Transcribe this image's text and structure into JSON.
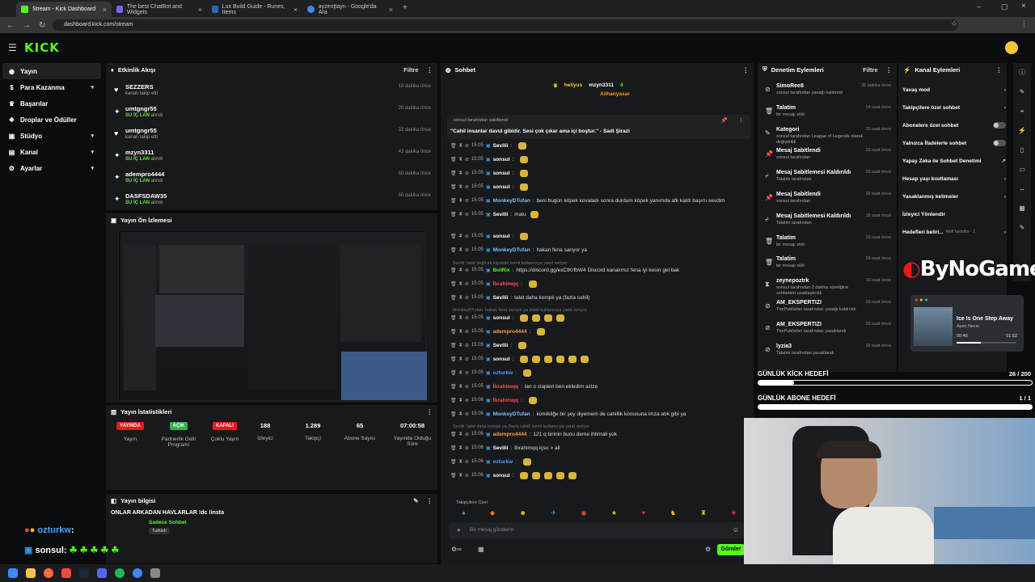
{
  "browser": {
    "tabs": [
      {
        "label": "Stream - Kick Dashboard",
        "color": "#53fc18"
      },
      {
        "label": "The best ChatBot and Widgets",
        "color": "#7b61ff"
      },
      {
        "label": "Lux Build Guide - Runes, Items",
        "color": "#2b6cb0"
      },
      {
        "label": "ayzenţtayn - Google'da Ara",
        "color": "#4285f4"
      }
    ],
    "url": "dashboard.kick.com/stream"
  },
  "brand": {
    "logo": "KICK"
  },
  "sidebar": {
    "items": [
      {
        "label": "Yayın",
        "icon": "broadcast-icon",
        "chev": false
      },
      {
        "label": "Para Kazanma",
        "icon": "money-icon",
        "chev": true
      },
      {
        "label": "Başarılar",
        "icon": "trophy-icon",
        "chev": false
      },
      {
        "label": "Droplar ve Ödüller",
        "icon": "gift-icon",
        "chev": false
      },
      {
        "label": "Stüdyo",
        "icon": "studio-icon",
        "chev": true
      },
      {
        "label": "Kanal",
        "icon": "channel-icon",
        "chev": true
      },
      {
        "label": "Ayarlar",
        "icon": "settings-icon",
        "chev": true
      }
    ]
  },
  "activity": {
    "title": "Etkinlik Akışı",
    "filter": "Filtre",
    "items": [
      {
        "name": "SEZZERS",
        "sub": "kanalı takip etti",
        "highlight": "",
        "time": "18 dakika önce",
        "icon": "heart-icon"
      },
      {
        "name": "umtgngr55",
        "sub": " alındı",
        "highlight": "SU İÇ LAN",
        "time": "20 dakika önce",
        "icon": "gift-icon"
      },
      {
        "name": "umtgngr55",
        "sub": "kanalı takip etti",
        "highlight": "",
        "time": "32 dakika önce",
        "icon": "heart-icon"
      },
      {
        "name": "mzyn3311",
        "sub": " alındı",
        "highlight": "SU İÇ LAN",
        "time": "43 dakika önce",
        "icon": "gift-icon"
      },
      {
        "name": "adempro4444",
        "sub": " alındı",
        "highlight": "SU İÇ LAN",
        "time": "50 dakika önce",
        "icon": "gift-icon"
      },
      {
        "name": "DASFSDAW35",
        "sub": " alındı",
        "highlight": "SU İÇ LAN",
        "time": "50 dakika önce",
        "icon": "gift-icon"
      }
    ]
  },
  "preview": {
    "title": "Yayın Ön İzlemesi"
  },
  "stats": {
    "title": "Yayın İstatistikleri",
    "items": [
      {
        "badge": "YAYINDA",
        "badge_color": "#e91916",
        "label": "Yayın"
      },
      {
        "badge": "AÇIK",
        "badge_color": "#2fb34a",
        "label": "Partnerlik Gelir Programı"
      },
      {
        "badge": "KAPALI",
        "badge_color": "#e91916",
        "label": "Çoklu Yayın"
      },
      {
        "value": "188",
        "label": "İzleyici"
      },
      {
        "value": "1.289",
        "label": "Takipçi"
      },
      {
        "value": "65",
        "label": "Abone Sayısı"
      },
      {
        "value": "07:00:58",
        "label": "Yayında Olduğu Süre"
      }
    ]
  },
  "streaminfo": {
    "title": "Yayın bilgisi",
    "name": "ONLAR ARKADAN HAVLARLAR !dc !insta",
    "tag": "Sadece Sohbet",
    "category": "Turkish"
  },
  "overlay_chat": [
    {
      "user": "ozturkw",
      "text": ":"
    },
    {
      "user": "sonsul",
      "text": ":"
    }
  ],
  "chat": {
    "title": "Sohbet",
    "top": [
      {
        "name": "heliyus",
        "count": "7"
      },
      {
        "name": "mzyn3311",
        "count": "4"
      },
      {
        "name": "Alihanyasar",
        "count": "1"
      }
    ],
    "pinned": {
      "by": "sonsul tarafından sabitlendi",
      "text": "\"Cahil insanlar davul gibidir. Sesi çok çıkar ama içi boştur.\" - Sadi Şirazi"
    },
    "lines": [
      {
        "time": "15:05",
        "user": "Sevilii",
        "ucolor": "#ffffff",
        "text": "",
        "emotes": 1
      },
      {
        "time": "15:05",
        "user": "sonsul",
        "ucolor": "#ffffff",
        "text": "",
        "emotes": 1
      },
      {
        "time": "15:05",
        "user": "sonsul",
        "ucolor": "#ffffff",
        "text": "",
        "emotes": 1
      },
      {
        "time": "15:05",
        "user": "sonsul",
        "ucolor": "#ffffff",
        "text": "",
        "emotes": 1
      },
      {
        "time": "15:05",
        "user": "MonkeyDTufan",
        "ucolor": "#7dc0ff",
        "text": "beni bugün köpek kovaladı sonra durdum köpek yanımda afk kaldı başını sevdim",
        "emotes": 0
      },
      {
        "time": "15:05",
        "user": "Sevilii",
        "ucolor": "#ffffff",
        "text": "matu",
        "emotes": 1
      },
      {
        "time": "15:05",
        "user": "sonsul",
        "ucolor": "#ffffff",
        "text": "",
        "emotes": 1
      },
      {
        "time": "15:05",
        "user": "MonkeyDTufan",
        "ucolor": "#7dc0ff",
        "text": "hakan fena sarıyor ya",
        "emotes": 0
      },
      {
        "time": "15:05",
        "user": "BotRix",
        "ucolor": "#53fc18",
        "text": "https://discord.gg/exCtKrfbW4 Discord kanalımız fena iyi kesin gel bak",
        "emotes": 0
      },
      {
        "time": "15:05",
        "user": "İbrahimqq",
        "ucolor": "#ff4d4d",
        "text": "",
        "emotes": 1
      },
      {
        "time": "15:05",
        "user": "Sevilii",
        "ucolor": "#ffffff",
        "text": "talat daha kompk ya (fazla cahil)",
        "emotes": 0
      },
      {
        "time": "15:05",
        "user": "sonsul",
        "ucolor": "#ffffff",
        "text": "",
        "emotes": 4
      },
      {
        "time": "15:05",
        "user": "adempro4444",
        "ucolor": "#ff9a3c",
        "text": "",
        "emotes": 1
      },
      {
        "time": "15:05",
        "user": "Sevilii",
        "ucolor": "#ffffff",
        "text": "",
        "emotes": 1
      },
      {
        "time": "15:05",
        "user": "sonsul",
        "ucolor": "#ffffff",
        "text": "",
        "emotes": 6
      },
      {
        "time": "15:05",
        "user": "ozturkw",
        "ucolor": "#4aa3ff",
        "text": "",
        "emotes": 1
      },
      {
        "time": "15:05",
        "user": "İbrahimqq",
        "ucolor": "#ff4d4d",
        "text": "lan o clapleri ben ekledim azize",
        "emotes": 0
      },
      {
        "time": "15:06",
        "user": "İbrahimqq",
        "ucolor": "#ff4d4d",
        "text": "",
        "emotes": 1
      },
      {
        "time": "15:06",
        "user": "MonkeyDTufan",
        "ucolor": "#7dc0ff",
        "text": "komikliğe bir şey diyemem de cahillik konusuna imza atık gibi ya",
        "emotes": 0
      },
      {
        "time": "15:06",
        "user": "adempro4444",
        "ucolor": "#ff9a3c",
        "text": "121 q birinin bunu deme ihtimali yok",
        "emotes": 0
      },
      {
        "time": "15:06",
        "user": "Sevilii",
        "ucolor": "#ffffff",
        "text": "İbrahimqq içsu > all",
        "emotes": 0
      },
      {
        "time": "15:06",
        "user": "ozturkw",
        "ucolor": "#4aa3ff",
        "text": "",
        "emotes": 1
      },
      {
        "time": "15:06",
        "user": "sonsul",
        "ucolor": "#ffffff",
        "text": "",
        "emotes": 5
      }
    ],
    "replies": [
      {
        "text": "Sevilii: talat değil mi kişiskdü isimli kullanıcıya yanıt veriyor"
      },
      {
        "text": "MonkeyDTufan: hakan fena sarıyor ya isimli kullanıcıya yanıt veriyor"
      },
      {
        "text": "Sevilii: talat daha kompk ya (fazla cahil) isimli kullanıcıya yanıt veriyor"
      }
    ],
    "followers_only": "Takipçilere Özel",
    "input_placeholder": "Bir mesaj gönderin",
    "send": "Gönder"
  },
  "modlog": {
    "title": "Denetim Eylemleri",
    "filter": "Filtre",
    "items": [
      {
        "name": "SimoRee8",
        "sub": "sonsul tarafından yasağı kaldırıldı",
        "time": "35 dakika önce",
        "icon": "ban-icon"
      },
      {
        "name": "Talatim",
        "sub": "bir mesajı sildi",
        "time": "14 saat önce",
        "icon": "trash-icon"
      },
      {
        "name": "Kategori",
        "sub": "sonsul tarafından League of Legends olarak değiştirildi",
        "time": "15 saat önce",
        "icon": "edit-icon"
      },
      {
        "name": "Mesaj Sabitlendi",
        "sub": "sonsul tarafından",
        "time": "15 saat önce",
        "icon": "pin-icon"
      },
      {
        "name": "Mesaj Sabitlemesi Kaldırıldı",
        "sub": "Talatim tarafından",
        "time": "15 saat önce",
        "icon": "unpin-icon"
      },
      {
        "name": "Mesaj Sabitlendi",
        "sub": "sonsul tarafından",
        "time": "16 saat önce",
        "icon": "pin-icon"
      },
      {
        "name": "Mesaj Sabitlemesi Kaldırıldı",
        "sub": "Talatim tarafından",
        "time": "16 saat önce",
        "icon": "unpin-icon"
      },
      {
        "name": "Talatim",
        "sub": "bir mesajı sildi",
        "time": "16 saat önce",
        "icon": "trash-icon"
      },
      {
        "name": "Talatim",
        "sub": "bir mesajı sildi",
        "time": "16 saat önce",
        "icon": "trash-icon"
      },
      {
        "name": "zeynepoztrk",
        "sub": "sonsul tarafından 2 dakika süreliğine sohbetten uzaklaştırıldı",
        "time": "16 saat önce",
        "icon": "timeout-icon"
      },
      {
        "name": "AM_EKSPERTIZI",
        "sub": "ThePublisher tarafından yasağı kaldırıldı",
        "time": "16 saat önce",
        "icon": "ban-icon"
      },
      {
        "name": "AM_EKSPERTIZI",
        "sub": "ThePublisher tarafından yasaklandı",
        "time": "16 saat önce",
        "icon": "ban-icon"
      },
      {
        "name": "lyzia3",
        "sub": "Talatim tarafından yasaklandı",
        "time": "16 saat önce",
        "icon": "ban-icon"
      }
    ]
  },
  "channel_actions": {
    "title": "Kanal Eylemleri",
    "items": [
      {
        "label": "Yavaş mod",
        "type": "arrow"
      },
      {
        "label": "Takipçilere özel sohbet",
        "type": "arrow"
      },
      {
        "label": "Abonelere özel sohbet",
        "type": "toggle"
      },
      {
        "label": "Yalnızca İfadelerle sohbet",
        "type": "toggle"
      },
      {
        "label": "Yapay Zeka ile Sohbet Denetimi",
        "type": "link"
      },
      {
        "label": "Hesap yaşı kısıtlaması",
        "type": "arrow"
      },
      {
        "label": "Yasaklanmış kelimeler",
        "type": "arrow"
      },
      {
        "label": "İzleyici Yönlendir",
        "type": "none"
      },
      {
        "label": "Hedefleri belirl...",
        "type": "arrow",
        "extra": "Aktif hedefler - 1"
      }
    ]
  },
  "overlay": {
    "brand": "ByNoGame",
    "music_title": "Ice Is One Step Away",
    "music_artist": "Ayen Necio",
    "elapsed": "00:46",
    "total": "01:52",
    "goal1_label": "GÜNLÜK KİCK HEDEFİ",
    "goal1_value": "26 / 200",
    "goal1_progress": 0.13,
    "goal2_label": "GÜNLÜK ABONE HEDEFİ",
    "goal2_value": "1 / 1",
    "goal2_progress": 1.0
  }
}
